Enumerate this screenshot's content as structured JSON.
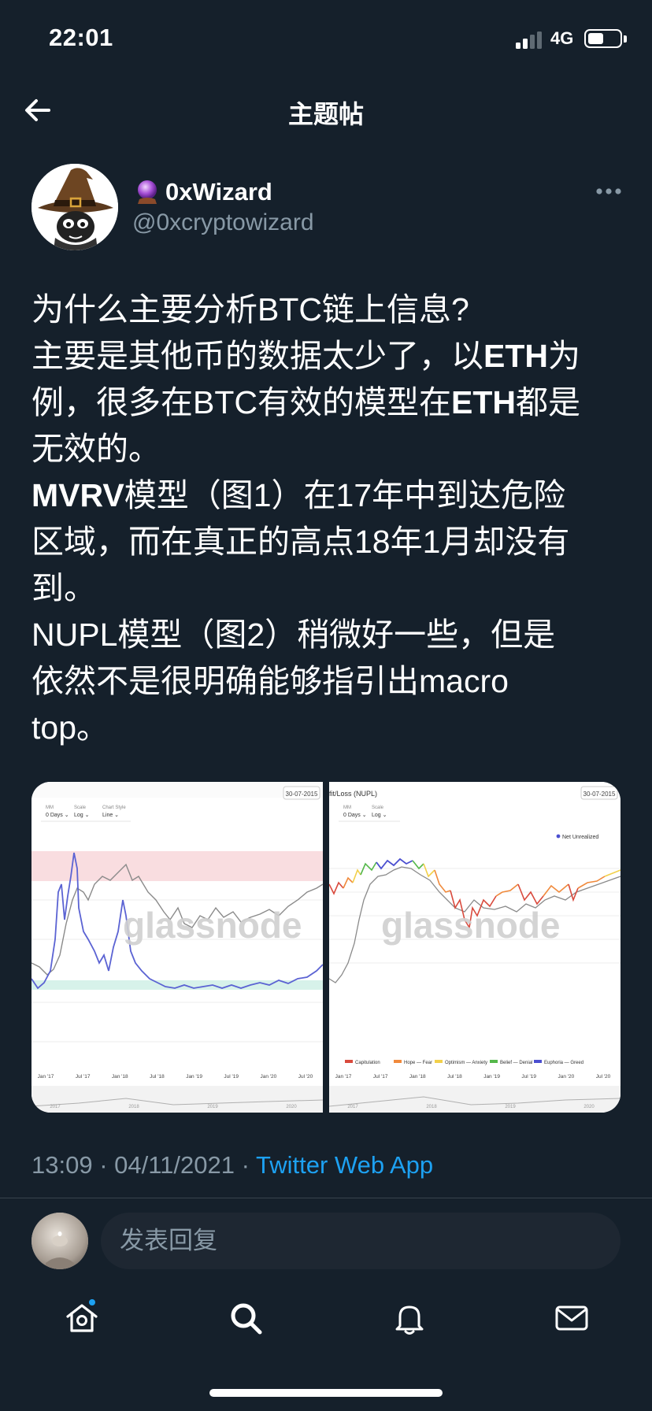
{
  "status_bar": {
    "time": "22:01",
    "network": "4G",
    "battery_level": 0.45,
    "signal_icon": "signal-bars-icon"
  },
  "header": {
    "title": "主题帖",
    "back_icon": "arrow-left-icon"
  },
  "author": {
    "display_name": "0xWizard",
    "handle": "@0xcryptowizard",
    "name_emoji_icon": "crystal-ball-icon",
    "avatar_icon": "wizard-hat-cat-avatar",
    "more_icon": "more-horizontal-icon"
  },
  "tweet": {
    "lines": [
      [
        {
          "t": "为什么主要分析BTC链上信息?"
        }
      ],
      [
        {
          "t": "主要是其他币的数据太少了，以"
        },
        {
          "t": "ETH",
          "b": true
        },
        {
          "t": "为"
        }
      ],
      [
        {
          "t": "例，很多在BTC有效的模型在"
        },
        {
          "t": "ETH",
          "b": true
        },
        {
          "t": "都是"
        }
      ],
      [
        {
          "t": "无效的。"
        }
      ],
      [
        {
          "t": "MVRV",
          "b": true
        },
        {
          "t": "模型（图1）在17年中到达危险"
        }
      ],
      [
        {
          "t": "区域，而在真正的高点18年1月却没有"
        }
      ],
      [
        {
          "t": "到。"
        }
      ],
      [
        {
          "t": "NUPL模型（图2）稍微好一些，但是"
        }
      ],
      [
        {
          "t": "依然不是很明确能够指引出macro"
        }
      ],
      [
        {
          "t": "top。"
        }
      ]
    ]
  },
  "media": {
    "chart1": {
      "date_box": "30-07-2015",
      "controls": [
        {
          "label": "MM",
          "value": "0 Days"
        },
        {
          "label": "Scale",
          "value": "Log"
        },
        {
          "label": "Chart Style",
          "value": "Line"
        }
      ],
      "watermark": "glassnode",
      "x_ticks": [
        "Jan '17",
        "Jul '17",
        "Jan '18",
        "Jul '18",
        "Jan '19",
        "Jul '19",
        "Jan '20",
        "Jul '20"
      ],
      "nav_ticks": [
        "2017",
        "2018",
        "2019",
        "2020"
      ],
      "colors": {
        "series": "#5b63d3",
        "price": "#8a8a8a",
        "danger_zone": "#f8d7da",
        "safe_zone": "#d7f2ea"
      }
    },
    "chart2": {
      "title": "fit/Loss (NUPL)",
      "date_box": "30-07-2015",
      "controls": [
        {
          "label": "MM",
          "value": "0 Days"
        },
        {
          "label": "Scale",
          "value": "Log"
        }
      ],
      "legend_top": "Net Unrealized",
      "watermark": "glassnode",
      "x_ticks": [
        "Jan '17",
        "Jul '17",
        "Jan '18",
        "Jul '18",
        "Jan '19",
        "Jul '19",
        "Jan '20",
        "Jul '20"
      ],
      "nav_ticks": [
        "2017",
        "2018",
        "2019",
        "2020"
      ],
      "legend": [
        {
          "label": "Capitulation",
          "color": "#d94a3d"
        },
        {
          "label": "Hope — Fear",
          "color": "#f08a3c"
        },
        {
          "label": "Optimism — Anxiety",
          "color": "#f2d04b"
        },
        {
          "label": "Belief — Denial",
          "color": "#55b84a"
        },
        {
          "label": "Euphoria — Greed",
          "color": "#4b4fd0"
        }
      ]
    }
  },
  "meta": {
    "time": "13:09",
    "sep1": " · ",
    "date": "04/11/2021",
    "sep2": " · ",
    "source": "Twitter Web App"
  },
  "reply": {
    "placeholder": "发表回复",
    "avatar_icon": "user-avatar"
  },
  "tabs": [
    {
      "name": "home",
      "icon": "home-icon",
      "badge": true
    },
    {
      "name": "search",
      "icon": "search-icon"
    },
    {
      "name": "notifications",
      "icon": "bell-icon"
    },
    {
      "name": "messages",
      "icon": "mail-icon"
    }
  ],
  "colors": {
    "background": "#15202b",
    "accent": "#1da1f2",
    "secondary_text": "#8899a6"
  }
}
